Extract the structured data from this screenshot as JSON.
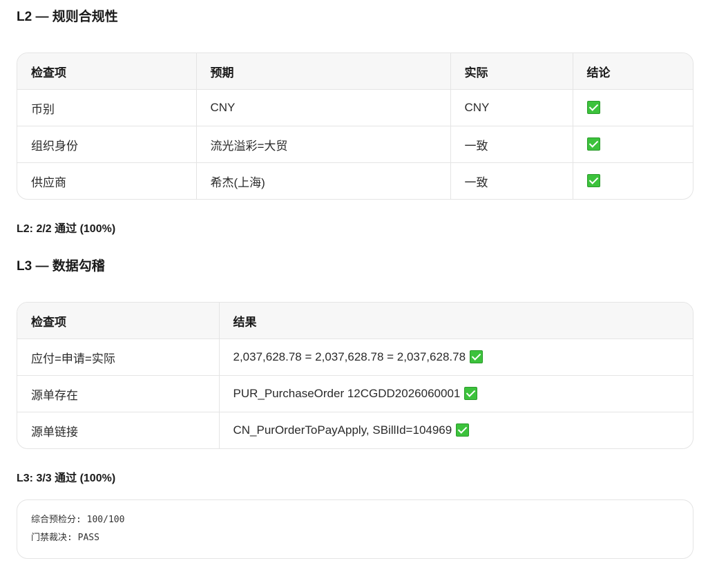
{
  "l2": {
    "heading": "L2 — 规则合规性",
    "columns": [
      "检查项",
      "预期",
      "实际",
      "结论"
    ],
    "rows": [
      {
        "item": "币别",
        "expected": "CNY",
        "actual": "CNY",
        "result": "pass"
      },
      {
        "item": "组织身份",
        "expected": "流光溢彩=大贸",
        "actual": "一致",
        "result": "pass"
      },
      {
        "item": "供应商",
        "expected": "希杰(上海)",
        "actual": "一致",
        "result": "pass"
      }
    ],
    "summary": "L2: 2/2 通过 (100%)"
  },
  "l3": {
    "heading": "L3 — 数据勾稽",
    "columns": [
      "检查项",
      "结果"
    ],
    "rows": [
      {
        "item": "应付=申请=实际",
        "result": "2,037,628.78 = 2,037,628.78 = 2,037,628.78"
      },
      {
        "item": "源单存在",
        "result": "PUR_PurchaseOrder 12CGDD2026060001"
      },
      {
        "item": "源单链接",
        "result": "CN_PurOrderToPayApply, SBillId=104969"
      }
    ],
    "summary": "L3: 3/3 通过 (100%)"
  },
  "code_block": {
    "line1": "综合预检分: 100/100",
    "line2": "门禁裁决: PASS"
  },
  "icons": {
    "pass": "check-mark-button-icon"
  },
  "colors": {
    "check_green": "#3cc23c",
    "border": "#e4e4e4",
    "header_bg": "#f7f7f7"
  }
}
